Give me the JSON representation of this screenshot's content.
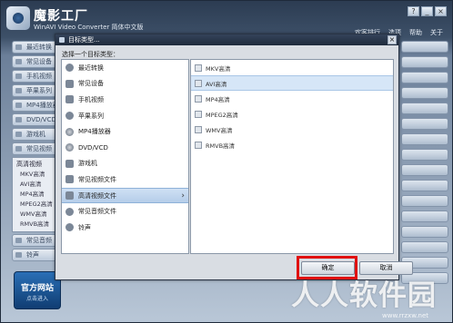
{
  "app": {
    "title": "魔影工厂",
    "subtitle": "WinAVI Video Converter 简体中文版",
    "top_links": [
      "欢客排行",
      "选项",
      "帮助",
      "关于"
    ],
    "window_controls": [
      "?",
      "_",
      "×"
    ]
  },
  "left_panel": {
    "items": [
      "最近转换",
      "常见设备",
      "手机视频",
      "苹果系列",
      "MP4播放器",
      "DVD/VCD",
      "游戏机",
      "常见视频"
    ],
    "expanded": {
      "label": "高清视频",
      "children": [
        "MKV高清",
        "AVI高清",
        "MP4高清",
        "MPEG2高清",
        "WMV高清",
        "RMVB高清"
      ]
    },
    "bottom_items": [
      "常见音频",
      "铃声"
    ],
    "promo_title": "官方网站",
    "promo_sub": "点击进入"
  },
  "dialog": {
    "title": "目标类型...",
    "close_glyph": "×",
    "prompt": "选择一个目标类型：",
    "types": [
      {
        "label": "最近转换",
        "icon": "clock-icon"
      },
      {
        "label": "常见设备",
        "icon": "device-icon"
      },
      {
        "label": "手机视频",
        "icon": "phone-icon"
      },
      {
        "label": "苹果系列",
        "icon": "apple-icon"
      },
      {
        "label": "MP4播放器",
        "icon": "mp4-player-icon"
      },
      {
        "label": "DVD/VCD",
        "icon": "disc-icon"
      },
      {
        "label": "游戏机",
        "icon": "gamepad-icon"
      },
      {
        "label": "常见视频文件",
        "icon": "film-icon"
      },
      {
        "label": "高清视频文件",
        "icon": "hd-video-icon",
        "selected": true
      },
      {
        "label": "常见音频文件",
        "icon": "music-icon"
      },
      {
        "label": "铃声",
        "icon": "bell-icon"
      }
    ],
    "selected_arrow": "›",
    "formats": [
      "MKV高清",
      "AVI高清",
      "MP4高清",
      "MPEG2高清",
      "WMV高清",
      "RMVB高清"
    ],
    "highlighted_format_index": 1,
    "ok_label": "确定",
    "cancel_label": "取消",
    "highlight_color": "#e01010"
  },
  "watermark": {
    "text": "人人软件园",
    "sub": "www.rrzxw.net"
  }
}
